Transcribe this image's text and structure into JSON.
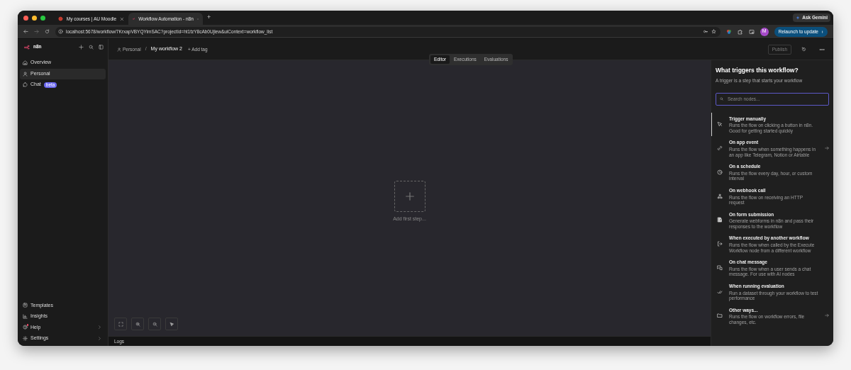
{
  "browser": {
    "tabs": [
      {
        "title": "My courses | AU Moodle",
        "selected": false,
        "kind": "moodle"
      },
      {
        "title": "Workflow Automation - n8n",
        "selected": true,
        "kind": "n8n"
      }
    ],
    "new_tab": "+",
    "gemini": "Ask Gemini",
    "url": "localhost:5678/workflow/7KrxapVBYQYimSAC?projectId=ht1fzY8cAb0Ujlew&uiContext=workflow_list",
    "profile_initial": "M",
    "relaunch": "Relaunch to update"
  },
  "sidebar": {
    "logo": "n8n",
    "items": [
      {
        "label": "Overview",
        "selected": false
      },
      {
        "label": "Personal",
        "selected": true
      },
      {
        "label": "Chat",
        "selected": false,
        "badge": "beta"
      }
    ],
    "bottom_items": [
      {
        "label": "Templates",
        "notification": false,
        "expandable": false
      },
      {
        "label": "Insights",
        "notification": false,
        "expandable": false
      },
      {
        "label": "Help",
        "notification": true,
        "expandable": true
      },
      {
        "label": "Settings",
        "notification": false,
        "expandable": true
      }
    ]
  },
  "header": {
    "project": "Personal",
    "separator": "/",
    "workflow_name": "My workflow 2",
    "add_tag": "+ Add tag",
    "publish": "Publish",
    "tabs": [
      {
        "label": "Editor",
        "selected": true
      },
      {
        "label": "Executions",
        "selected": false
      },
      {
        "label": "Evaluations",
        "selected": false
      }
    ]
  },
  "canvas": {
    "add_first_step": "Add first step...",
    "logs": "Logs"
  },
  "trigger_panel": {
    "title": "What triggers this workflow?",
    "subtitle": "A trigger is a step that starts your workflow",
    "search_placeholder": "Search nodes...",
    "items": [
      {
        "title": "Trigger manually",
        "description": "Runs the flow on clicking a button in n8n. Good for getting started quickly",
        "selected": true,
        "arrow": false
      },
      {
        "title": "On app event",
        "description": "Runs the flow when something happens in an app like Telegram, Notion or Airtable",
        "selected": false,
        "arrow": true
      },
      {
        "title": "On a schedule",
        "description": "Runs the flow every day, hour, or custom interval",
        "selected": false,
        "arrow": false
      },
      {
        "title": "On webhook call",
        "description": "Runs the flow on receiving an HTTP request",
        "selected": false,
        "arrow": false
      },
      {
        "title": "On form submission",
        "description": "Generate webforms in n8n and pass their responses to the workflow",
        "selected": false,
        "arrow": false
      },
      {
        "title": "When executed by another workflow",
        "description": "Runs the flow when called by the Execute Workflow node from a different workflow",
        "selected": false,
        "arrow": false
      },
      {
        "title": "On chat message",
        "description": "Runs the flow when a user sends a chat message. For use with AI nodes",
        "selected": false,
        "arrow": false
      },
      {
        "title": "When running evaluation",
        "description": "Run a dataset through your workflow to test performance",
        "selected": false,
        "arrow": false
      },
      {
        "title": "Other ways...",
        "description": "Runs the flow on workflow errors, file changes, etc.",
        "selected": false,
        "arrow": true
      }
    ]
  }
}
